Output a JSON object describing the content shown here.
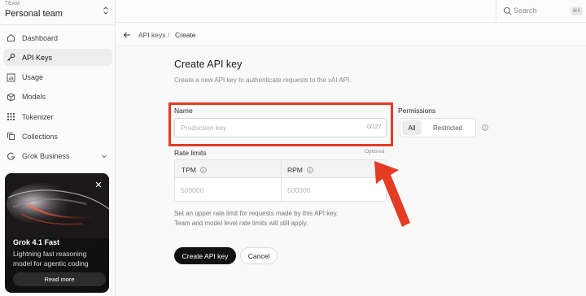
{
  "team": {
    "caption": "TEAM",
    "name": "Personal team"
  },
  "sidebar": {
    "items": [
      {
        "label": "Dashboard",
        "icon": "home-icon"
      },
      {
        "label": "API Keys",
        "icon": "key-icon",
        "active": true
      },
      {
        "label": "Usage",
        "icon": "bar-chart-icon"
      },
      {
        "label": "Models",
        "icon": "cube-icon"
      },
      {
        "label": "Tokenizer",
        "icon": "grid-icon"
      },
      {
        "label": "Collections",
        "icon": "copy-icon"
      },
      {
        "label": "Grok Business",
        "icon": "grok-icon"
      }
    ]
  },
  "promo": {
    "title": "Grok 4.1 Fast",
    "description": "Lightning fast reasoning model for agentic coding",
    "button": "Read more"
  },
  "search": {
    "placeholder": "Search",
    "shortcut": "⌘K"
  },
  "breadcrumb": {
    "parent": "API keys",
    "separator": "/",
    "current": "Create"
  },
  "form": {
    "title": "Create API key",
    "subtitle": "Create a new API key to authenticate requests to the xAI API.",
    "name_label": "Name",
    "name_placeholder": "Production key",
    "name_counter": "0/127",
    "permissions_label": "Permissions",
    "permission_options": [
      "All",
      "Restricted"
    ],
    "permission_selected": "All",
    "rate_limits_label": "Rate limits",
    "optional_label": "Optional",
    "tpm_label": "TPM",
    "rpm_label": "RPM",
    "tpm_placeholder": "500000",
    "rpm_placeholder": "500000",
    "help_line1": "Set an upper rate limit for requests made by this API key.",
    "help_line2": "Team and model level rate limits will still apply.",
    "submit": "Create API key",
    "cancel": "Cancel"
  },
  "colors": {
    "accent": "#121212",
    "annotation": "#e33b24"
  }
}
